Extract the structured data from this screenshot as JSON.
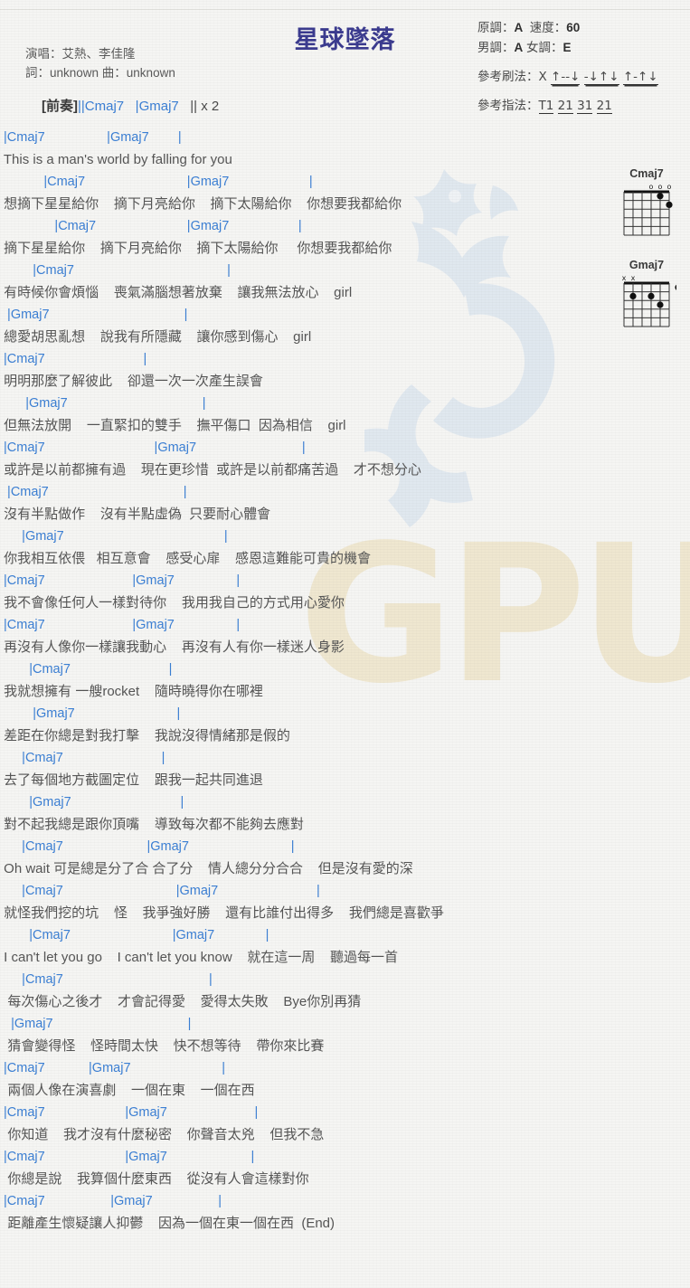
{
  "header": {
    "title": "星球墜落",
    "credits": [
      "演唱：艾熱、李佳隆",
      "詞：unknown  曲：unknown"
    ],
    "intro_label": "[前奏]",
    "intro_chords": "||Cmaj7   |Gmaj7   || x 2",
    "intro_bar1": "||",
    "intro_chord1": "Cmaj7",
    "intro_bar2": "|",
    "intro_chord2": "Gmaj7",
    "intro_tail": "|| x 2"
  },
  "meta": {
    "original_key_label": "原調：",
    "original_key": "A",
    "tempo_label": "速度：",
    "tempo": "60",
    "male_key_label": "男調：",
    "male_key": "A",
    "female_key_label": "女調：",
    "female_key": "E",
    "strum_label": "參考刷法：",
    "strum_pattern": "X ↑--↓ -↓↑↓ ↑-↑↓",
    "strum_parts": [
      "X",
      "↑--↓",
      "-↓↑↓",
      "↑-↑↓"
    ],
    "pick_label": "參考指法：",
    "pick_pattern": "T1 21 31 21",
    "pick_parts": [
      "T1",
      "21",
      "31",
      "21"
    ]
  },
  "diagrams": [
    {
      "name": "Cmaj7",
      "markers": [
        "",
        "",
        "",
        "o",
        "o",
        "o"
      ],
      "dots": [
        {
          "string": 5,
          "fret": 2
        },
        {
          "string": 4,
          "fret": 1
        }
      ]
    },
    {
      "name": "Gmaj7",
      "markers": [
        "x",
        "x",
        "",
        "",
        "",
        ""
      ],
      "dots": [
        {
          "string": 1,
          "fret": 2
        },
        {
          "string": 3,
          "fret": 2
        },
        {
          "string": 4,
          "fret": 3
        },
        {
          "string": 6,
          "fret": 1
        }
      ]
    }
  ],
  "colors": {
    "chord": "#3b7fd4",
    "lyric": "#555555",
    "title": "#3b3b8f",
    "watermark_blue": "#c5d6ea",
    "watermark_beige": "#efe7d0",
    "page_bg": "#f5f5f3"
  },
  "lines": [
    {
      "chord": " |Cmaj7                 |Gmaj7        |",
      "lyric": " This is a man's world by falling for you"
    },
    {
      "chord": "            |Cmaj7                            |Gmaj7                      |",
      "lyric": " 想摘下星星給你    摘下月亮給你    摘下太陽給你    你想要我都給你"
    },
    {
      "chord": "               |Cmaj7                         |Gmaj7                   |",
      "lyric": " 摘下星星給你    摘下月亮給你    摘下太陽給你     你想要我都給你"
    },
    {
      "chord": "         |Cmaj7                                          |",
      "lyric": " 有時候你會煩惱    喪氣滿腦想著放棄    讓我無法放心    girl"
    },
    {
      "chord": "  |Gmaj7                                     |",
      "lyric": " 總愛胡思亂想    說我有所隱藏    讓你感到傷心    girl"
    },
    {
      "chord": " |Cmaj7                           |",
      "lyric": " 明明那麼了解彼此    卻還一次一次產生誤會"
    },
    {
      "chord": "       |Gmaj7                                     |",
      "lyric": " 但無法放開    一直緊扣的雙手    撫平傷口  因為相信    girl"
    },
    {
      "chord": " |Cmaj7                              |Gmaj7                             |",
      "lyric": " 或許是以前都擁有過    現在更珍惜  或許是以前都痛苦過    才不想分心"
    },
    {
      "chord": "  |Cmaj7                                     |",
      "lyric": " 沒有半點做作    沒有半點虛偽  只要耐心體會"
    },
    {
      "chord": "      |Gmaj7                                            |",
      "lyric": " 你我相互依偎   相互意會    感受心扉    感恩這難能可貴的機會"
    },
    {
      "chord": " |Cmaj7                        |Gmaj7                 |",
      "lyric": " 我不會像任何人一樣對待你    我用我自己的方式用心愛你"
    },
    {
      "chord": " |Cmaj7                        |Gmaj7                 |",
      "lyric": " 再沒有人像你一樣讓我動心    再沒有人有你一樣迷人身影"
    },
    {
      "chord": "        |Cmaj7                           |",
      "lyric": " 我就想擁有 一艘rocket    隨時曉得你在哪裡"
    },
    {
      "chord": "         |Gmaj7                            |",
      "lyric": " 差距在你總是對我打擊    我說沒得情緒那是假的"
    },
    {
      "chord": "      |Cmaj7                           |",
      "lyric": " 去了每個地方截圖定位    跟我一起共同進退"
    },
    {
      "chord": "        |Gmaj7                              |",
      "lyric": " 對不起我總是跟你頂嘴    導致每次都不能夠去應對"
    },
    {
      "chord": "      |Cmaj7                       |Gmaj7                            |",
      "lyric": " Oh wait 可是總是分了合 合了分    情人總分分合合    但是沒有愛的深"
    },
    {
      "chord": "      |Cmaj7                               |Gmaj7                           |",
      "lyric": " 就怪我們挖的坑    怪    我爭強好勝    還有比誰付出得多    我們總是喜歡爭"
    },
    {
      "chord": "        |Cmaj7                            |Gmaj7              |",
      "lyric": " I can't let you go    I can't let you know    就在這一周    聽過每一首"
    },
    {
      "chord": "      |Cmaj7                                        |",
      "lyric": "  每次傷心之後才    才會記得愛    愛得太失敗    Bye你別再猜"
    },
    {
      "chord": "   |Gmaj7                                     |",
      "lyric": "  猜會變得怪    怪時間太快    快不想等待    帶你來比賽"
    },
    {
      "chord": " |Cmaj7            |Gmaj7                         |",
      "lyric": "  兩個人像在演喜劇    一個在東    一個在西"
    },
    {
      "chord": " |Cmaj7                      |Gmaj7                        |",
      "lyric": "  你知道    我才沒有什麼秘密    你聲音太兇    但我不急"
    },
    {
      "chord": " |Cmaj7                      |Gmaj7                       |",
      "lyric": "  你總是說    我算個什麼東西    從沒有人會這樣對你"
    },
    {
      "chord": " |Cmaj7                  |Gmaj7                  |",
      "lyric": "  距離產生懷疑讓人抑鬱    因為一個在東一個在西  (End)"
    }
  ]
}
